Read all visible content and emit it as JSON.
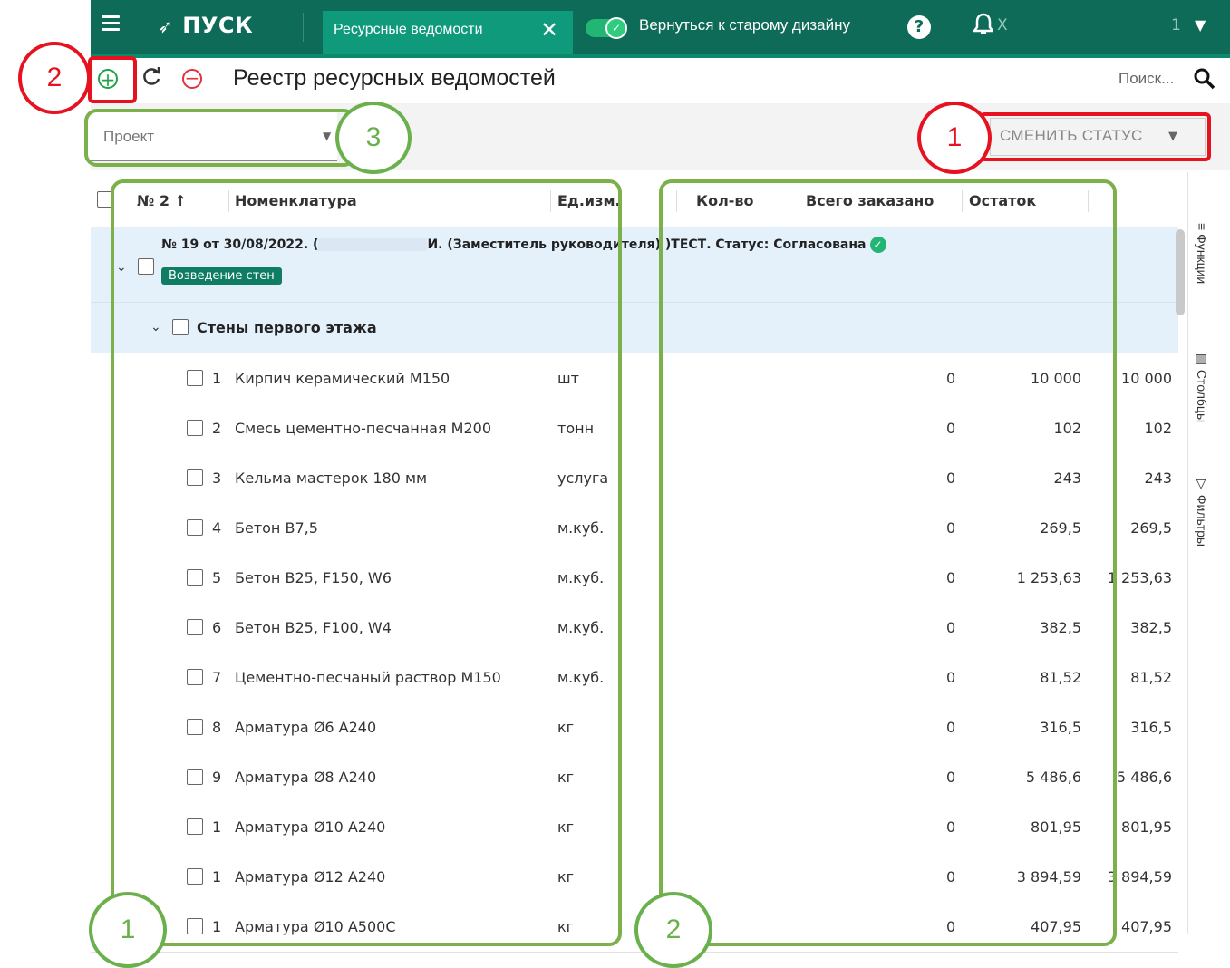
{
  "topbar": {
    "logo": "ПУСК",
    "tab_label": "Ресурсные ведомости",
    "old_design_label": "Вернуться к старому дизайну",
    "user_initial": "Х",
    "user_suffix": "1"
  },
  "toolbar": {
    "title": "Реестр ресурсных ведомостей",
    "search_placeholder": "Поиск..."
  },
  "filters": {
    "project_label": "Проект",
    "change_status_label": "СМЕНИТЬ СТАТУС"
  },
  "table": {
    "headers": {
      "number": "№ 2 ↑",
      "nomenclature": "Номенклатура",
      "unit": "Ед.изм.",
      "qty": "Кол-во",
      "ordered": "Всего заказано",
      "rest": "Остаток"
    },
    "group": {
      "title_prefix": "№ 19 от 30/08/2022. (",
      "title_suffix": "И. (Заместитель руководителя) )ТЕСТ. Статус: Согласована",
      "tag": "Возведение стен"
    },
    "subgroup": {
      "title": "Стены первого этажа"
    },
    "rows": [
      {
        "num": "1",
        "name": "Кирпич керамический М150",
        "unit": "шт",
        "qty": "10 000",
        "ordered": "0",
        "rest": "10 000"
      },
      {
        "num": "2",
        "name": "Смесь цементно-песчанная М200",
        "unit": "тонн",
        "qty": "102",
        "ordered": "0",
        "rest": "102"
      },
      {
        "num": "3",
        "name": "Кельма мастерок 180 мм",
        "unit": "услуга",
        "qty": "243",
        "ordered": "0",
        "rest": "243"
      },
      {
        "num": "4",
        "name": "Бетон В7,5",
        "unit": "м.куб.",
        "qty": "269,5",
        "ordered": "0",
        "rest": "269,5"
      },
      {
        "num": "5",
        "name": "Бетон В25, F150, W6",
        "unit": "м.куб.",
        "qty": "1 253,63",
        "ordered": "0",
        "rest": "1 253,63"
      },
      {
        "num": "6",
        "name": "Бетон В25, F100, W4",
        "unit": "м.куб.",
        "qty": "382,5",
        "ordered": "0",
        "rest": "382,5"
      },
      {
        "num": "7",
        "name": "Цементно-песчаный раствор М150",
        "unit": "м.куб.",
        "qty": "81,52",
        "ordered": "0",
        "rest": "81,52"
      },
      {
        "num": "8",
        "name": "Арматура Ø6 А240",
        "unit": "кг",
        "qty": "316,5",
        "ordered": "0",
        "rest": "316,5"
      },
      {
        "num": "9",
        "name": "Арматура Ø8 А240",
        "unit": "кг",
        "qty": "5 486,6",
        "ordered": "0",
        "rest": "5 486,6"
      },
      {
        "num": "1",
        "name": "Арматура Ø10 А240",
        "unit": "кг",
        "qty": "801,95",
        "ordered": "0",
        "rest": "801,95"
      },
      {
        "num": "1",
        "name": "Арматура Ø12 А240",
        "unit": "кг",
        "qty": "3 894,59",
        "ordered": "0",
        "rest": "3 894,59"
      },
      {
        "num": "1",
        "name": "Арматура Ø10 А500С",
        "unit": "кг",
        "qty": "407,95",
        "ordered": "0",
        "rest": "407,95"
      }
    ]
  },
  "side_panel": {
    "functions": "Функции",
    "columns": "Столбцы",
    "filters": "Фильтры"
  },
  "annotations": {
    "red_1": "1",
    "red_2": "2",
    "green_3": "3",
    "green_1": "1",
    "green_2": "2"
  },
  "colors": {
    "header_green": "#0e6b57",
    "tab_green": "#0f9a7b",
    "annotation_red": "#e6121f",
    "annotation_green": "#6ab04c",
    "group_bg": "#e4f1fb"
  }
}
